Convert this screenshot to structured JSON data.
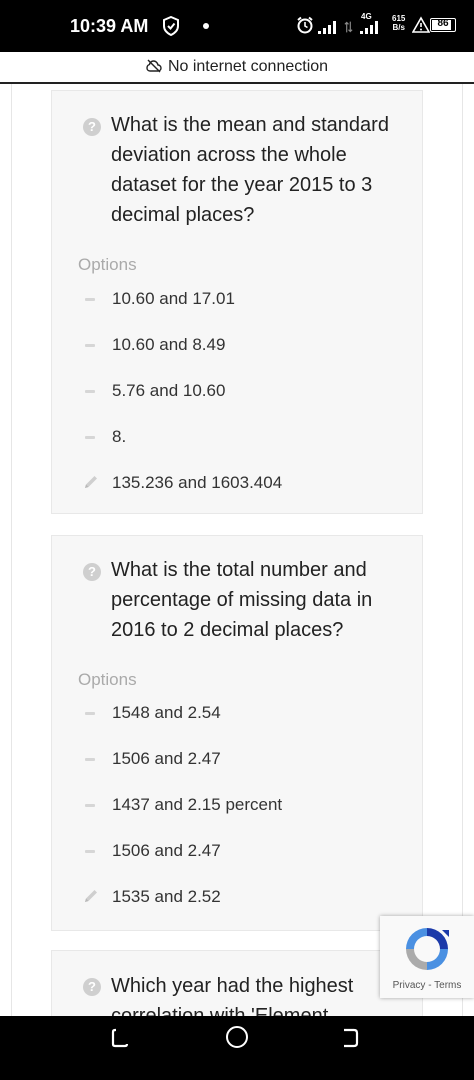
{
  "status_bar": {
    "time": "10:39 AM",
    "network": "4G",
    "speed_value": "615",
    "speed_unit": "B/s",
    "battery": "86",
    "icons": [
      "shield-icon",
      "dot-icon",
      "alarm-icon",
      "signal-icon",
      "signal-4g-icon",
      "warning-icon",
      "battery-icon"
    ]
  },
  "offline_banner": {
    "text": "No internet connection",
    "icon": "cloud-off-icon"
  },
  "questions": [
    {
      "text": "What is the mean and standard deviation across the whole dataset for the year 2015 to 3 decimal places?",
      "options_label": "Options",
      "options": [
        {
          "text": "10.60 and 17.01",
          "marker": "dash"
        },
        {
          "text": "10.60 and 8.49",
          "marker": "dash"
        },
        {
          "text": "5.76 and 10.60",
          "marker": "dash"
        },
        {
          "text": "8.",
          "marker": "dash"
        },
        {
          "text": "135.236 and 1603.404",
          "marker": "pencil"
        }
      ]
    },
    {
      "text": "What is the total number and percentage of missing data in 2016 to 2 decimal places?",
      "options_label": "Options",
      "options": [
        {
          "text": "1548 and 2.54",
          "marker": "dash"
        },
        {
          "text": "1506 and 2.47",
          "marker": "dash"
        },
        {
          "text": "1437 and 2.15 percent",
          "marker": "dash"
        },
        {
          "text": "1506 and 2.47",
          "marker": "dash"
        },
        {
          "text": "1535 and 2.52",
          "marker": "pencil"
        }
      ]
    },
    {
      "text": "Which year had the highest correlation with 'Element"
    }
  ],
  "recaptcha": {
    "privacy": "Privacy",
    "separator": " - ",
    "terms": "Terms"
  },
  "nav_bar": {
    "icons": [
      "back-icon",
      "home-icon",
      "recent-apps-icon"
    ]
  },
  "colors": {
    "status_bar_bg": "#000000",
    "card_bg": "#f7f7f7",
    "muted_text": "#aaaaaa",
    "body_text": "#222222"
  }
}
